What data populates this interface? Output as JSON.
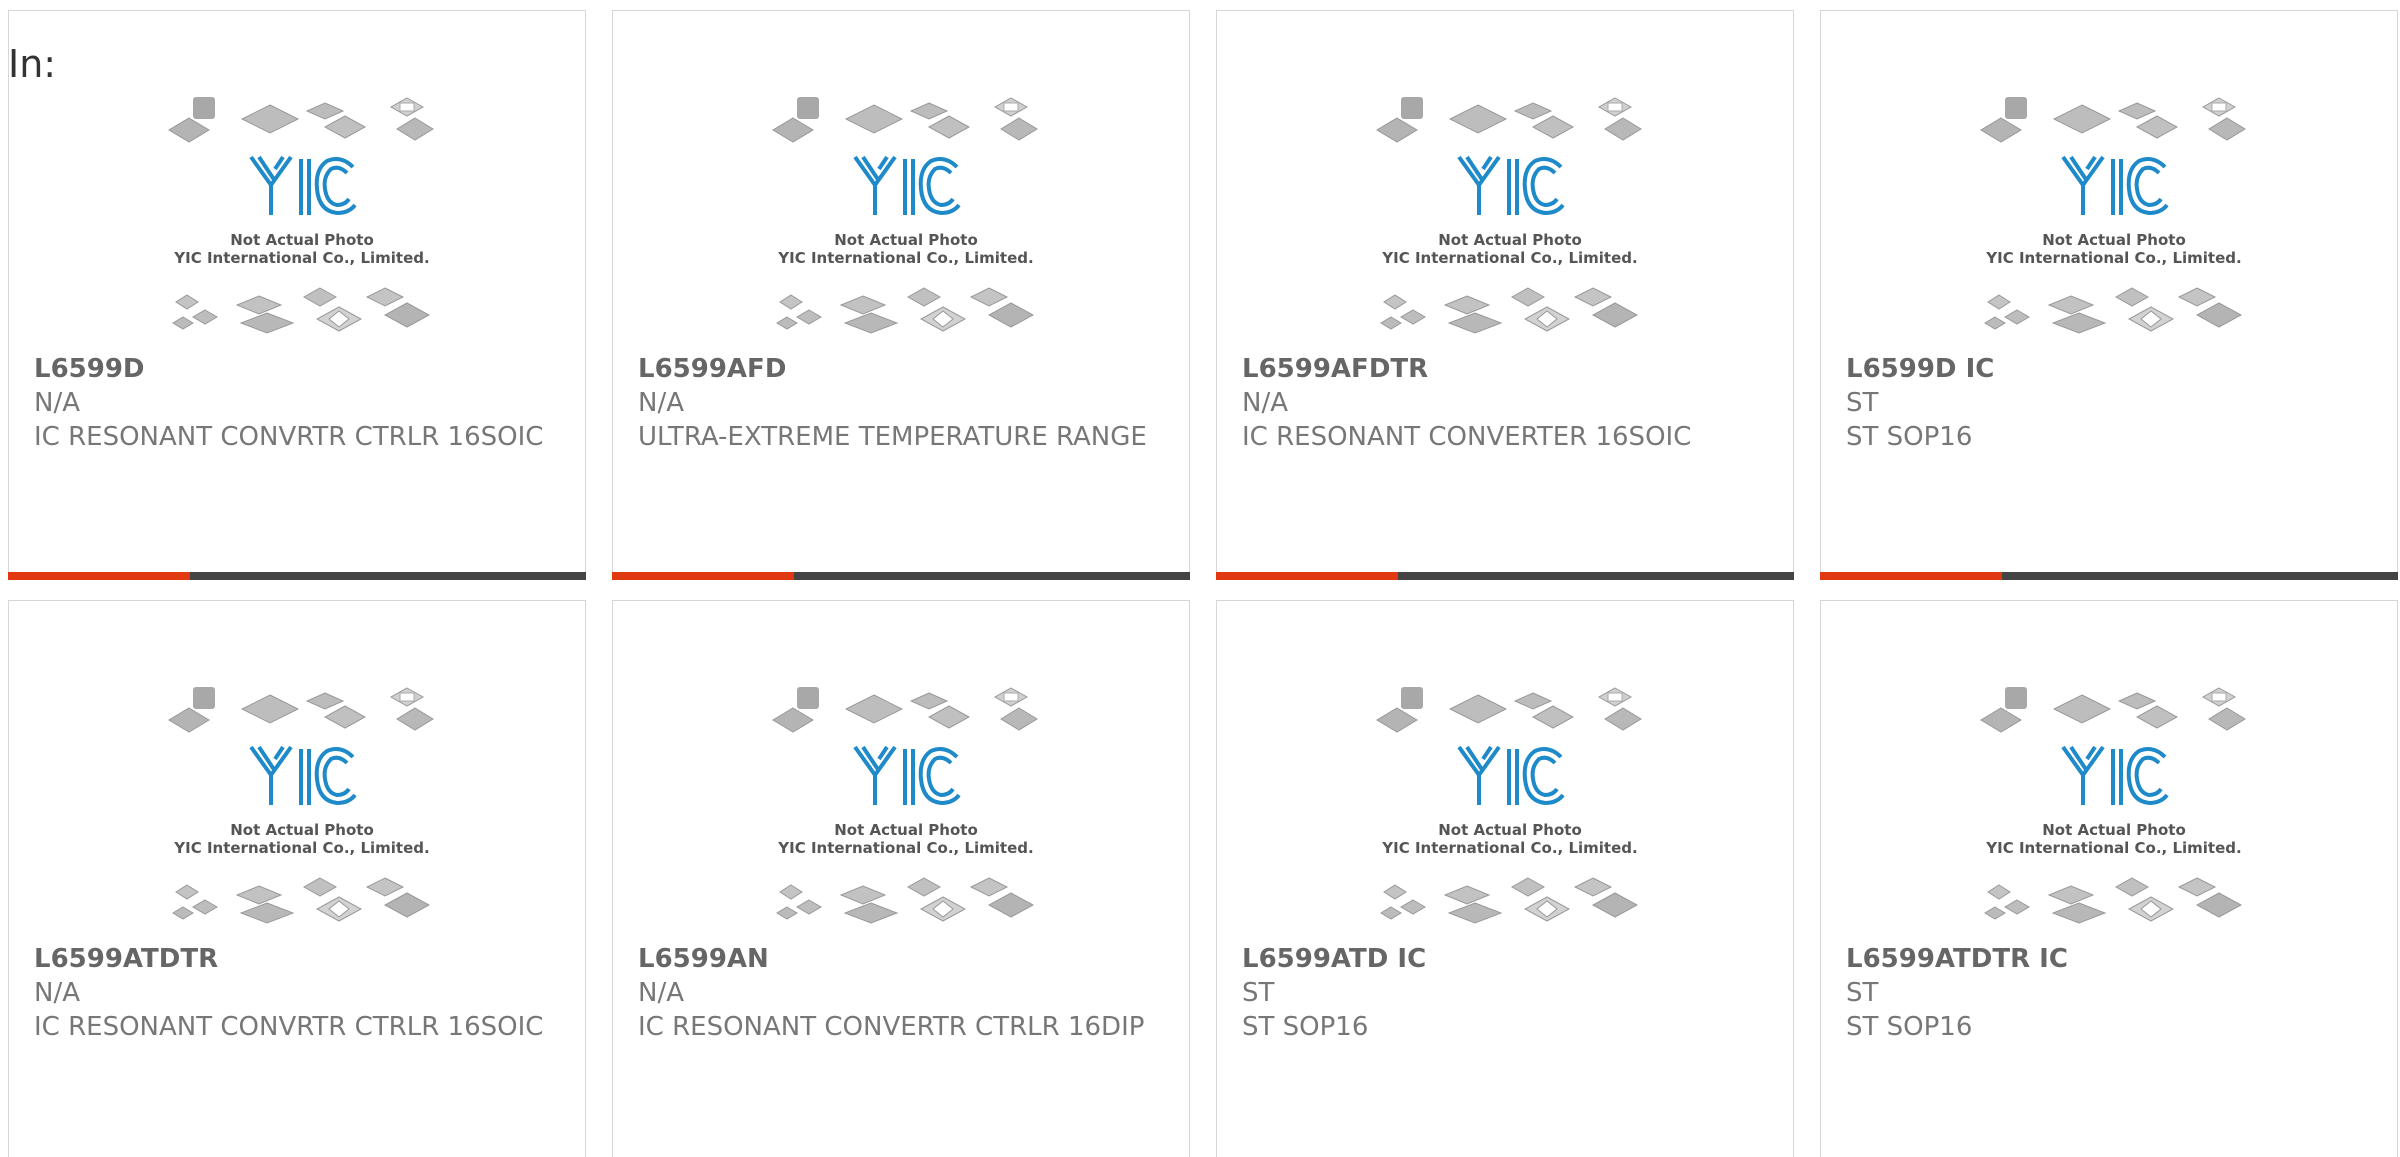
{
  "page": {
    "prefix_label": "In:"
  },
  "colors": {
    "accent": "#e13a13",
    "bar": "#444444",
    "logo_blue": "#1e8ac9",
    "text_gray": "#777777"
  },
  "placeholder_image": {
    "line1": "Not Actual Photo",
    "line2": "YIC International Co., Limited.",
    "logo_text": "YIC"
  },
  "products": [
    {
      "part": "L6599D",
      "maker": "N/A",
      "desc": "IC RESONANT CONVRTR CTRLR 16SOIC"
    },
    {
      "part": "L6599AFD",
      "maker": "N/A",
      "desc": "ULTRA-EXTREME TEMPERATURE RANGE"
    },
    {
      "part": "L6599AFDTR",
      "maker": "N/A",
      "desc": "IC RESONANT CONVERTER 16SOIC"
    },
    {
      "part": "L6599D IC",
      "maker": "ST",
      "desc": "ST SOP16"
    },
    {
      "part": "L6599ATDTR",
      "maker": "N/A",
      "desc": "IC RESONANT CONVRTR CTRLR 16SOIC"
    },
    {
      "part": "L6599AN",
      "maker": "N/A",
      "desc": "IC RESONANT CONVERTR CTRLR 16DIP"
    },
    {
      "part": "L6599ATD IC",
      "maker": "ST",
      "desc": "ST SOP16"
    },
    {
      "part": "L6599ATDTR IC",
      "maker": "ST",
      "desc": "ST SOP16"
    }
  ]
}
